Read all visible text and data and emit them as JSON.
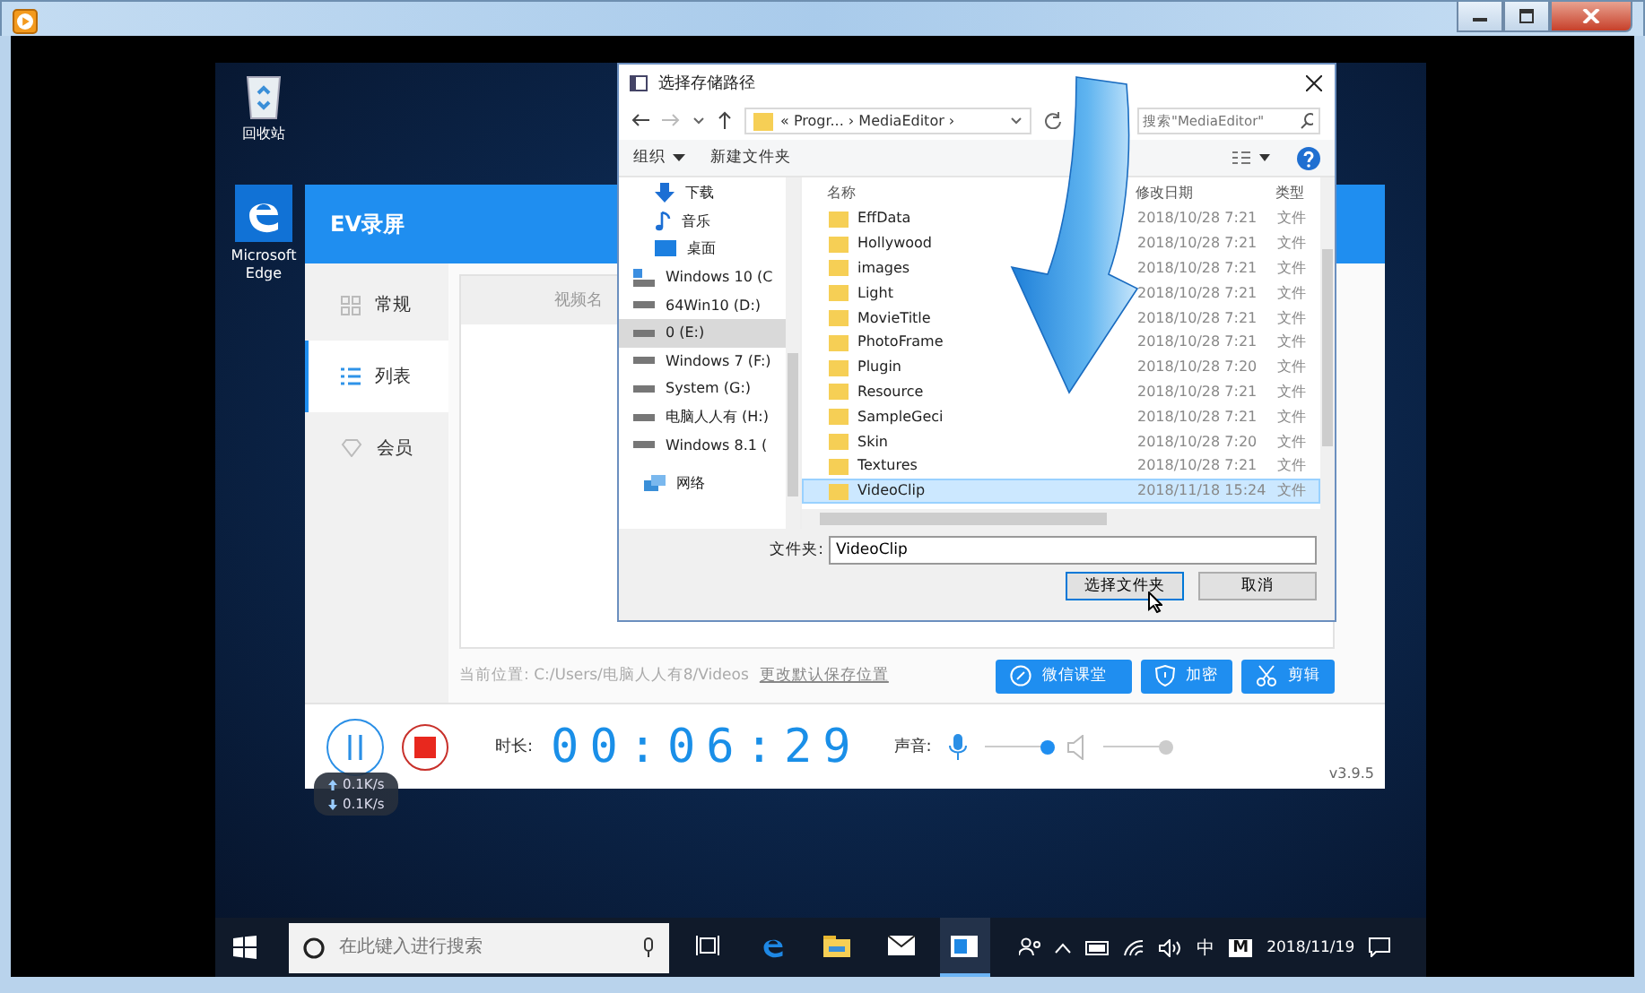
{
  "desktop_icons": [
    {
      "label": "回收站",
      "kind": "recycle"
    },
    {
      "label": "Microsoft Edge",
      "kind": "edge"
    }
  ],
  "ev_app": {
    "title": "EV录屏",
    "nav": [
      {
        "label": "常规",
        "kind": "grid",
        "selected": false
      },
      {
        "label": "列表",
        "kind": "list",
        "selected": true
      },
      {
        "label": "会员",
        "kind": "gem",
        "selected": false
      }
    ],
    "list_header": "视频名",
    "location_label": "当前位置: C:/Users/电脑人人有8/Videos",
    "location_link": "更改默认保存位置",
    "actions": [
      {
        "label": "微信课堂",
        "kind": "link"
      },
      {
        "label": "加密",
        "kind": "shield"
      },
      {
        "label": "剪辑",
        "kind": "scissors"
      }
    ],
    "duration_label": "时长:",
    "timer": "00:06:29",
    "sound_label": "声音:",
    "mic": {
      "level": 0.95,
      "enabled": true
    },
    "speaker": {
      "level": 0.95,
      "enabled": false
    },
    "version": "v3.9.5"
  },
  "speed": [
    {
      "text": "0.1K/s",
      "kind": "up"
    },
    {
      "text": "0.1K/s",
      "kind": "down"
    }
  ],
  "dialog": {
    "title": "选择存储路径",
    "path": "« Progr... › MediaEditor ›",
    "search_placeholder": "搜索\"MediaEditor\"",
    "organize": "组织",
    "new_folder": "新建文件夹",
    "nav": [
      {
        "label": "下载",
        "kind": "download",
        "selected": false
      },
      {
        "label": "音乐",
        "kind": "music",
        "selected": false
      },
      {
        "label": "桌面",
        "kind": "desktop",
        "selected": false
      },
      {
        "label": "Windows 10 (C",
        "kind": "system_drive",
        "selected": false
      },
      {
        "label": "64Win10 (D:)",
        "kind": "drive",
        "selected": false
      },
      {
        "label": "0 (E:)",
        "kind": "drive",
        "selected": true
      },
      {
        "label": "Windows 7 (F:)",
        "kind": "drive",
        "selected": false
      },
      {
        "label": "System (G:)",
        "kind": "drive",
        "selected": false
      },
      {
        "label": "电脑人人有 (H:)",
        "kind": "drive",
        "selected": false
      },
      {
        "label": "Windows 8.1 (",
        "kind": "drive",
        "selected": false
      },
      {
        "label": "网络",
        "kind": "network",
        "selected": false
      }
    ],
    "columns": [
      "名称",
      "修改日期",
      "类型"
    ],
    "rows": [
      {
        "name": "EffData",
        "date": "2018/10/28 7:21",
        "type": "文件",
        "selected": false
      },
      {
        "name": "Hollywood",
        "date": "2018/10/28 7:21",
        "type": "文件",
        "selected": false
      },
      {
        "name": "images",
        "date": "2018/10/28 7:21",
        "type": "文件",
        "selected": false
      },
      {
        "name": "Light",
        "date": "2018/10/28 7:21",
        "type": "文件",
        "selected": false
      },
      {
        "name": "MovieTitle",
        "date": "2018/10/28 7:21",
        "type": "文件",
        "selected": false
      },
      {
        "name": "PhotoFrame",
        "date": "2018/10/28 7:21",
        "type": "文件",
        "selected": false
      },
      {
        "name": "Plugin",
        "date": "2018/10/28 7:20",
        "type": "文件",
        "selected": false
      },
      {
        "name": "Resource",
        "date": "2018/10/28 7:21",
        "type": "文件",
        "selected": false
      },
      {
        "name": "SampleGeci",
        "date": "2018/10/28 7:21",
        "type": "文件",
        "selected": false
      },
      {
        "name": "Skin",
        "date": "2018/10/28 7:20",
        "type": "文件",
        "selected": false
      },
      {
        "name": "Textures",
        "date": "2018/10/28 7:21",
        "type": "文件",
        "selected": false
      },
      {
        "name": "VideoClip",
        "date": "2018/11/18 15:24",
        "type": "文件",
        "selected": true
      }
    ],
    "folder_label": "文件夹:",
    "folder_value": "VideoClip",
    "buttons": [
      {
        "label": "选择文件夹",
        "kind": "primary"
      },
      {
        "label": "取消",
        "kind": "normal"
      }
    ]
  },
  "taskbar": {
    "search_placeholder": "在此键入进行搜索",
    "apps": [
      {
        "kind": "taskview",
        "selected": false
      },
      {
        "kind": "edge",
        "selected": false
      },
      {
        "kind": "explorer",
        "selected": false
      },
      {
        "kind": "mail",
        "selected": false
      },
      {
        "kind": "recorder",
        "selected": true
      }
    ],
    "ime": "中",
    "ime_mode": "M",
    "date": "2018/11/19"
  }
}
